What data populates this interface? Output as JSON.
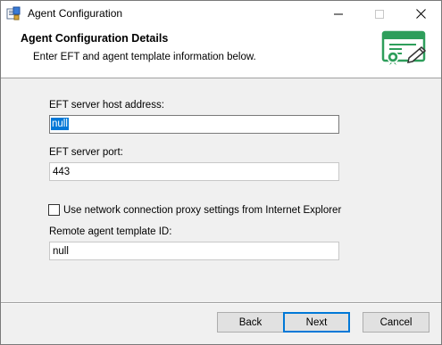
{
  "window": {
    "title": "Agent Configuration"
  },
  "header": {
    "title": "Agent Configuration Details",
    "subtitle": "Enter EFT and agent template information below.",
    "icon": "certificate-icon"
  },
  "form": {
    "host": {
      "label": "EFT server host address:",
      "value": "null"
    },
    "port": {
      "label": "EFT server port:",
      "value": "443"
    },
    "proxy": {
      "label": "Use network connection proxy settings from Internet Explorer",
      "checked": false
    },
    "template": {
      "label": "Remote agent template ID:",
      "value": "null"
    }
  },
  "buttons": {
    "back": "Back",
    "next": "Next",
    "cancel": "Cancel"
  },
  "colors": {
    "accent": "#0078d7",
    "certificate_green": "#2e9e5b"
  }
}
